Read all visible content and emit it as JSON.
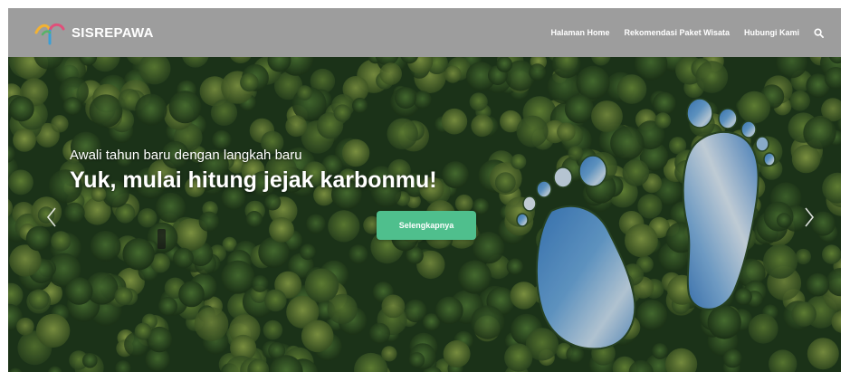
{
  "header": {
    "brand_name": "SISREPAWA",
    "logo_icon": "tree-swirl-logo-icon",
    "nav": [
      {
        "label": "Halaman Home"
      },
      {
        "label": "Rekomendasi Paket Wisata"
      },
      {
        "label": "Hubungi Kami"
      }
    ],
    "search_icon": "search-icon"
  },
  "hero": {
    "subtitle": "Awali tahun baru dengan langkah baru",
    "title": "Yuk, mulai hitung jejak karbonmu!",
    "cta_label": "Selengkapnya",
    "prev_icon": "chevron-left-icon",
    "next_icon": "chevron-right-icon"
  },
  "colors": {
    "navbar": "#9d9d9d",
    "cta": "#4fbf8d",
    "forest_dark": "#1f3a1c",
    "water": "#6aa6d9"
  }
}
